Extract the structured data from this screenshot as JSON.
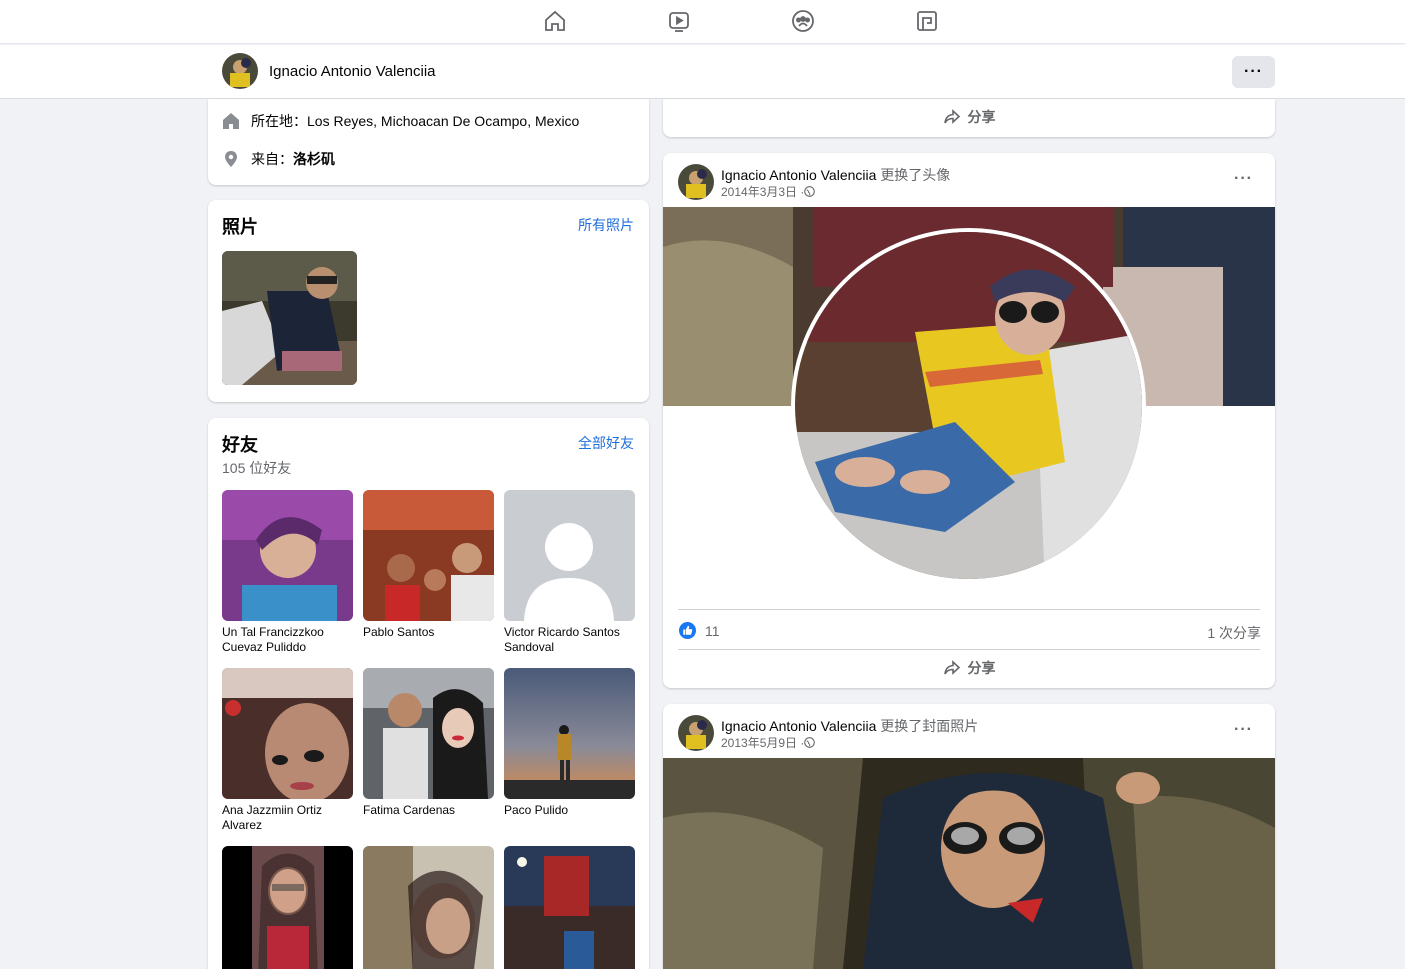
{
  "nav": {
    "icons": [
      "home-icon",
      "watch-icon",
      "groups-icon",
      "gaming-icon"
    ]
  },
  "profile": {
    "name": "Ignacio Antonio Valenciia",
    "more_label": "···"
  },
  "intro": {
    "lives_in": "所在地：Los Reyes, Michoacan De Ocampo, Mexico",
    "from_label": "来自：",
    "from_value": "洛杉矶"
  },
  "photos": {
    "title": "照片",
    "link": "所有照片"
  },
  "friends": {
    "title": "好友",
    "link": "全部好友",
    "count": "105 位好友",
    "items": [
      {
        "name": "Un Tal Francizzkoo Cuevaz Puliddo"
      },
      {
        "name": "Pablo Santos"
      },
      {
        "name": "Victor Ricardo Santos Sandoval"
      },
      {
        "name": "Ana Jazzmiin Ortiz Alvarez"
      },
      {
        "name": "Fatima Cardenas"
      },
      {
        "name": "Paco Pulido"
      },
      {
        "name": ""
      },
      {
        "name": ""
      },
      {
        "name": ""
      }
    ]
  },
  "posts": {
    "share_label": "分享",
    "post1": {
      "author": "Ignacio Antonio Valenciia",
      "action": "更换了头像",
      "date": "2014年3月3日 · ",
      "more": "···",
      "likes": "11",
      "shares": "1 次分享"
    },
    "post2": {
      "author": "Ignacio Antonio Valenciia",
      "action": "更换了封面照片",
      "date": "2013年5月9日 · ",
      "more": "···"
    }
  },
  "colors": {
    "accent": "#216fdb",
    "like": "#1877f2",
    "background": "#f0f2f5"
  }
}
